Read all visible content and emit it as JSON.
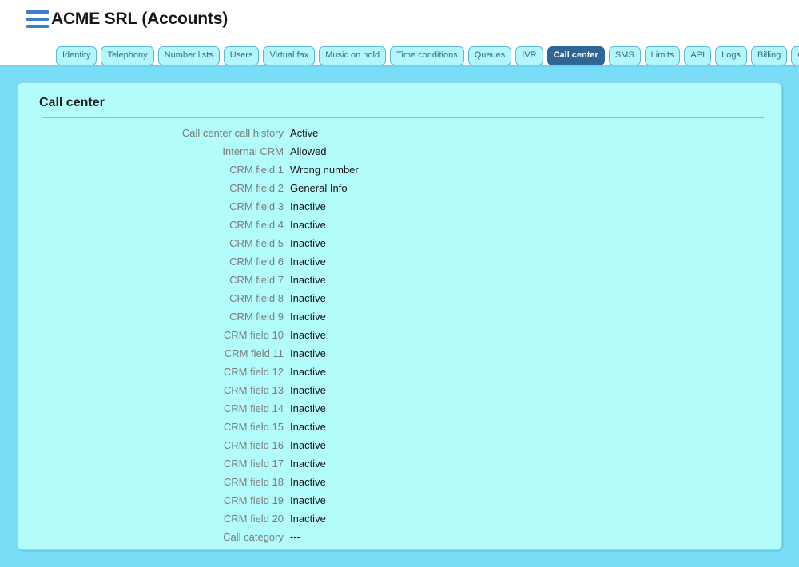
{
  "header": {
    "menu_icon": "hamburger-icon",
    "title": "ACME SRL (Accounts)"
  },
  "tabs": [
    {
      "label": "Identity",
      "active": false
    },
    {
      "label": "Telephony",
      "active": false
    },
    {
      "label": "Number lists",
      "active": false
    },
    {
      "label": "Users",
      "active": false
    },
    {
      "label": "Virtual fax",
      "active": false
    },
    {
      "label": "Music on hold",
      "active": false
    },
    {
      "label": "Time conditions",
      "active": false
    },
    {
      "label": "Queues",
      "active": false
    },
    {
      "label": "IVR",
      "active": false
    },
    {
      "label": "Call center",
      "active": true
    },
    {
      "label": "SMS",
      "active": false
    },
    {
      "label": "Limits",
      "active": false
    },
    {
      "label": "API",
      "active": false
    },
    {
      "label": "Logs",
      "active": false
    },
    {
      "label": "Billing",
      "active": false
    },
    {
      "label": "Operations",
      "active": false
    }
  ],
  "panel": {
    "title": "Call center",
    "rows": [
      {
        "label": "Call center call history",
        "value": "Active"
      },
      {
        "label": "Internal CRM",
        "value": "Allowed"
      },
      {
        "label": "CRM field 1",
        "value": "Wrong number"
      },
      {
        "label": "CRM field 2",
        "value": "General Info"
      },
      {
        "label": "CRM field 3",
        "value": "Inactive"
      },
      {
        "label": "CRM field 4",
        "value": "Inactive"
      },
      {
        "label": "CRM field 5",
        "value": "Inactive"
      },
      {
        "label": "CRM field 6",
        "value": "Inactive"
      },
      {
        "label": "CRM field 7",
        "value": "Inactive"
      },
      {
        "label": "CRM field 8",
        "value": "Inactive"
      },
      {
        "label": "CRM field 9",
        "value": "Inactive"
      },
      {
        "label": "CRM field 10",
        "value": "Inactive"
      },
      {
        "label": "CRM field 11",
        "value": "Inactive"
      },
      {
        "label": "CRM field 12",
        "value": "Inactive"
      },
      {
        "label": "CRM field 13",
        "value": "Inactive"
      },
      {
        "label": "CRM field 14",
        "value": "Inactive"
      },
      {
        "label": "CRM field 15",
        "value": "Inactive"
      },
      {
        "label": "CRM field 16",
        "value": "Inactive"
      },
      {
        "label": "CRM field 17",
        "value": "Inactive"
      },
      {
        "label": "CRM field 18",
        "value": "Inactive"
      },
      {
        "label": "CRM field 19",
        "value": "Inactive"
      },
      {
        "label": "CRM field 20",
        "value": "Inactive"
      },
      {
        "label": "Call category",
        "value": "---"
      }
    ]
  },
  "colors": {
    "page_background": "#7addf8",
    "panel_background": "#b3fcfc",
    "header_background": "#ffffff",
    "tab_background": "#b3f6fb",
    "tab_border": "#5ab8dd",
    "tab_text": "#3a6b80",
    "active_tab_background": "#2f6694",
    "active_tab_text": "#ffffff",
    "hamburger": "#3c7fc4",
    "label_text": "#7b7b7b",
    "value_text": "#131313"
  }
}
